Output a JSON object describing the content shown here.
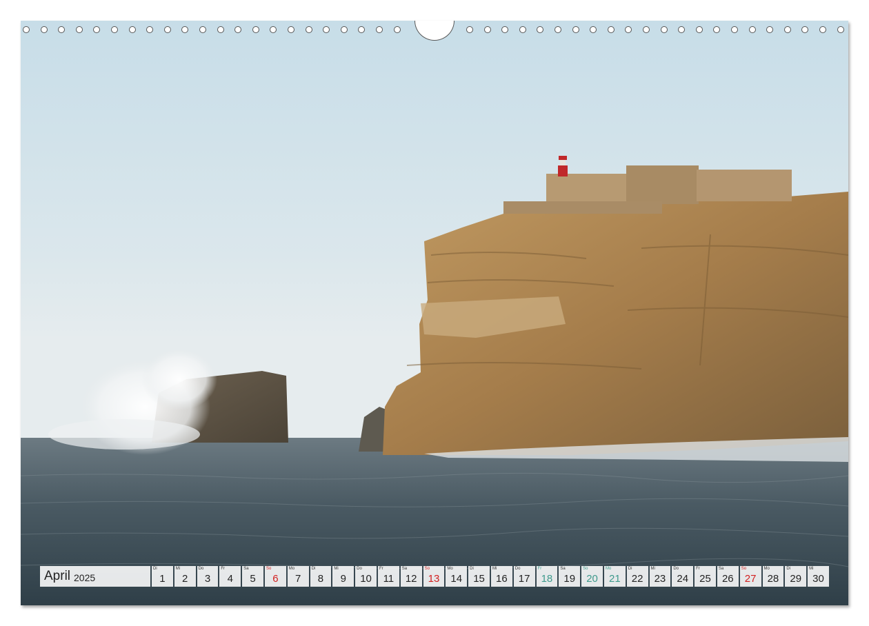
{
  "calendar": {
    "month": "April",
    "year": "2025",
    "days": [
      {
        "dow": "Di",
        "num": "1",
        "type": "normal"
      },
      {
        "dow": "Mi",
        "num": "2",
        "type": "normal"
      },
      {
        "dow": "Do",
        "num": "3",
        "type": "normal"
      },
      {
        "dow": "Fr",
        "num": "4",
        "type": "normal"
      },
      {
        "dow": "Sa",
        "num": "5",
        "type": "normal"
      },
      {
        "dow": "So",
        "num": "6",
        "type": "sun"
      },
      {
        "dow": "Mo",
        "num": "7",
        "type": "normal"
      },
      {
        "dow": "Di",
        "num": "8",
        "type": "normal"
      },
      {
        "dow": "Mi",
        "num": "9",
        "type": "normal"
      },
      {
        "dow": "Do",
        "num": "10",
        "type": "normal"
      },
      {
        "dow": "Fr",
        "num": "11",
        "type": "normal"
      },
      {
        "dow": "Sa",
        "num": "12",
        "type": "normal"
      },
      {
        "dow": "So",
        "num": "13",
        "type": "sun"
      },
      {
        "dow": "Mo",
        "num": "14",
        "type": "normal"
      },
      {
        "dow": "Di",
        "num": "15",
        "type": "normal"
      },
      {
        "dow": "Mi",
        "num": "16",
        "type": "normal"
      },
      {
        "dow": "Do",
        "num": "17",
        "type": "normal"
      },
      {
        "dow": "Fr",
        "num": "18",
        "type": "hol"
      },
      {
        "dow": "Sa",
        "num": "19",
        "type": "normal"
      },
      {
        "dow": "So",
        "num": "20",
        "type": "hol"
      },
      {
        "dow": "Mo",
        "num": "21",
        "type": "hol"
      },
      {
        "dow": "Di",
        "num": "22",
        "type": "normal"
      },
      {
        "dow": "Mi",
        "num": "23",
        "type": "normal"
      },
      {
        "dow": "Do",
        "num": "24",
        "type": "normal"
      },
      {
        "dow": "Fr",
        "num": "25",
        "type": "normal"
      },
      {
        "dow": "Sa",
        "num": "26",
        "type": "normal"
      },
      {
        "dow": "So",
        "num": "27",
        "type": "sun"
      },
      {
        "dow": "Mo",
        "num": "28",
        "type": "normal"
      },
      {
        "dow": "Di",
        "num": "29",
        "type": "normal"
      },
      {
        "dow": "Mi",
        "num": "30",
        "type": "normal"
      }
    ]
  },
  "colors": {
    "sunday": "#d21f1f",
    "holiday": "#3e9a8c"
  }
}
